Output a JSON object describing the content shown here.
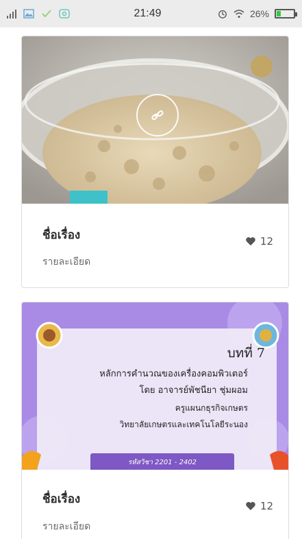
{
  "status_bar": {
    "time": "21:49",
    "battery": "26%",
    "battery_level": 0.26,
    "icons": [
      "signal-icon",
      "gallery-icon",
      "check-icon",
      "app-icon",
      "alarm-icon",
      "wifi-icon",
      "battery-icon"
    ]
  },
  "cards": [
    {
      "title": "ชื่อเรื่อง",
      "description": "รายละเอียด",
      "likes": "12",
      "image": "bowl-of-crumble-photo"
    },
    {
      "title": "ชื่อเรื่อง",
      "description": "รายละเอียด",
      "likes": "12",
      "image": {
        "chapter": "บทที่ 7",
        "line1": "หลักการคำนวณของเครื่องคอมพิวเตอร์",
        "line2": "โดย อาจารย์พัชนียา ชุ่มผอม",
        "line3": "ครูแผนกธุรกิจเกษตร",
        "line4": "วิทยาลัยเกษตรและเทคโนโลยีระนอง",
        "course_code": "รหัสวิชา 2201 - 2402"
      }
    }
  ],
  "colors": {
    "card_border": "#dcdcdc",
    "slide_purple": "#a98be6",
    "status_bar_bg": "#ececec"
  }
}
